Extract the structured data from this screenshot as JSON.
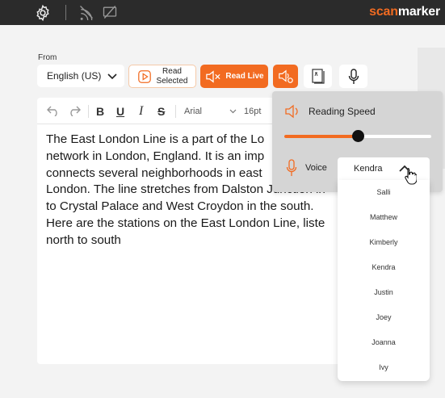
{
  "titlebar": {
    "brand_accent": "scan",
    "brand_rest": "marker",
    "icons": [
      "gear-icon",
      "no-signal-icon",
      "no-screen-icon"
    ]
  },
  "colors": {
    "accent": "#f26b21",
    "titlebar": "#2b2b2b",
    "panel": "#d5d5d5"
  },
  "from": {
    "label": "From",
    "language": "English (US)"
  },
  "buttons": {
    "read_selected_line1": "Read",
    "read_selected_line2": "Selected",
    "read_live": "Read Live"
  },
  "editor": {
    "font": "Arial",
    "size": "16pt",
    "lines": [
      "The East London Line is a part of the Lo",
      "network in London, England. It is an imp",
      "connects several neighborhoods in east",
      "London. The line stretches from Dalston Junction in",
      "to Crystal Palace and West Croydon in the south.",
      "Here are the stations on the East London Line, liste",
      "north to south"
    ]
  },
  "reading_speed": {
    "label": "Reading Speed",
    "value_fraction": 0.5,
    "voice_label": "Voice"
  },
  "voice": {
    "selected": "Kendra",
    "options": [
      "Salli",
      "Matthew",
      "Kimberly",
      "Kendra",
      "Justin",
      "Joey",
      "Joanna",
      "Ivy"
    ]
  }
}
